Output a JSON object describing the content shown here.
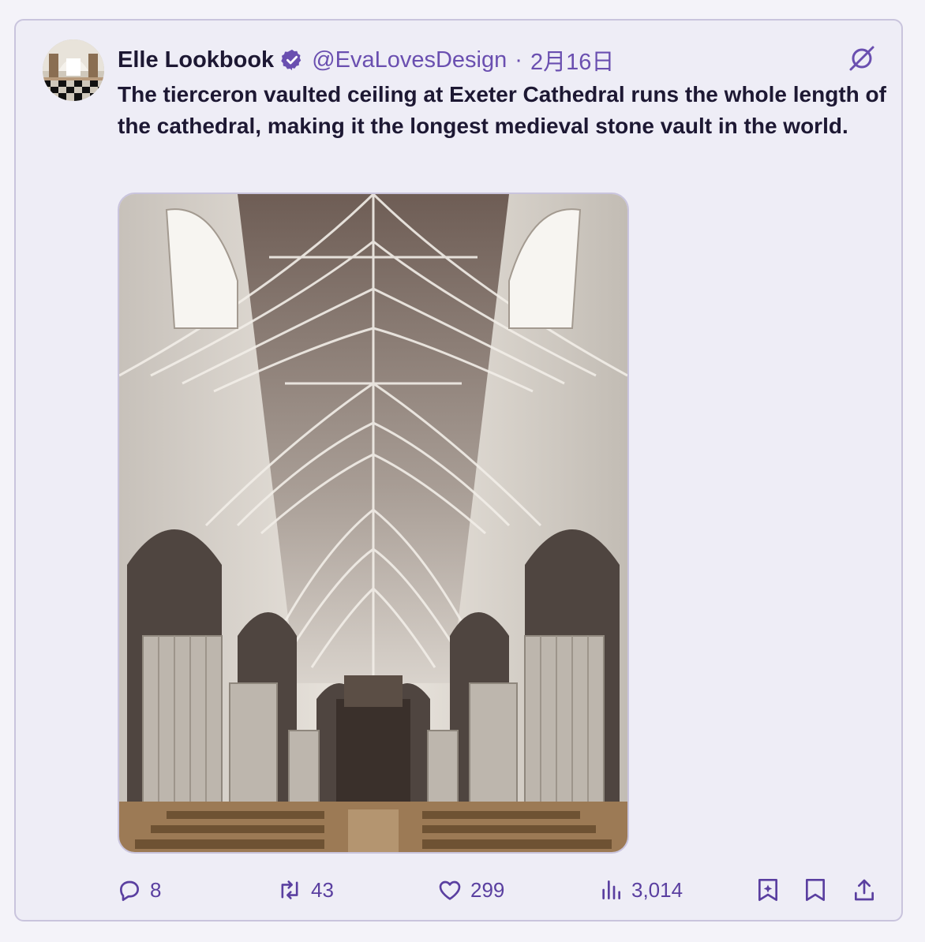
{
  "post": {
    "display_name": "Elle Lookbook",
    "handle": "@EvaLovesDesign",
    "separator": "·",
    "date": "2月16日",
    "text": "The tierceron vaulted ceiling at Exeter Cathedral runs the whole length of the cathedral, making it the longest medieval stone vault in the world."
  },
  "actions": {
    "replies": "8",
    "reposts": "43",
    "likes": "299",
    "views": "3,014"
  },
  "icons": {
    "verified": "verified-badge-icon",
    "grok": "grok-icon",
    "reply": "reply-icon",
    "repost": "repost-icon",
    "like": "heart-icon",
    "views": "views-icon",
    "bookmark_sparkle": "bookmark-sparkle-icon",
    "bookmark": "bookmark-icon",
    "share": "share-icon"
  },
  "colors": {
    "accent": "#6a4fb0",
    "text": "#1d1833",
    "card_bg": "#eeedf6"
  }
}
